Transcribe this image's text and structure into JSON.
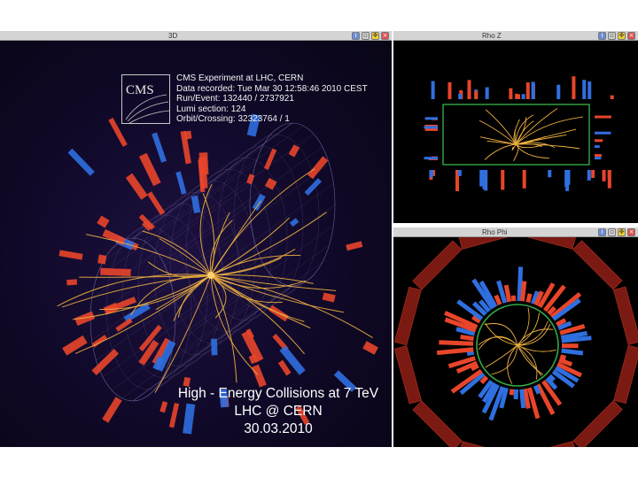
{
  "windows": {
    "main": {
      "title": "3D"
    },
    "top_right": {
      "title": "Rho Z"
    },
    "bottom_right": {
      "title": "Rho Phi"
    }
  },
  "window_buttons": {
    "info_glyph": "i",
    "image_glyph": "▫",
    "maximize_glyph": "✥",
    "close_glyph": "×"
  },
  "event_info": {
    "logo_text": "CMS",
    "lines": [
      "CMS Experiment at LHC, CERN",
      "Data recorded: Tue Mar 30 12:58:46 2010 CEST",
      "Run/Event: 132440 / 2737921",
      "Lumi section: 124",
      "Orbit/Crossing: 32323764 / 1"
    ]
  },
  "caption": {
    "line1": "High - Energy Collisions at 7 TeV",
    "line2": "LHC @ CERN",
    "line3": "30.03.2010"
  },
  "colors": {
    "track": "#f0b040",
    "ecal_tower": "#e8452a",
    "hcal_tower": "#2f6fe0",
    "muon_chamber": "#7a1a12",
    "tracker_outline": "#33a845",
    "wireframe": "#8f86c8",
    "titlebar": "#d4d4d4"
  }
}
